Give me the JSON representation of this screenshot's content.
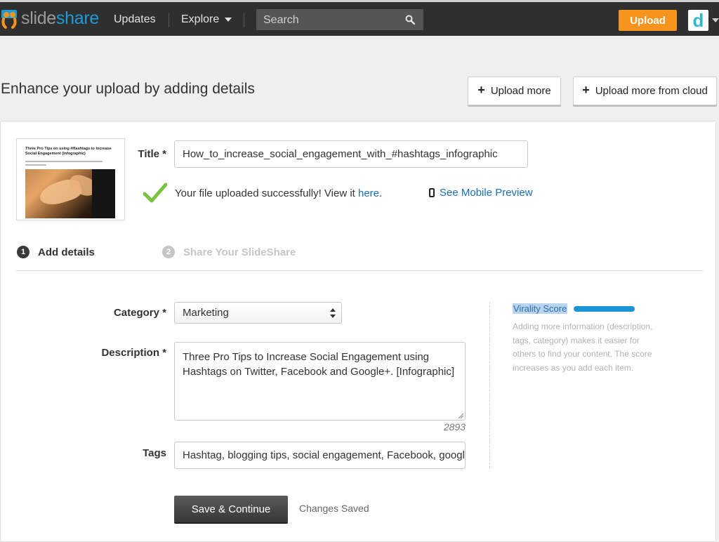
{
  "header": {
    "logo_part1": "slide",
    "logo_part2": "share",
    "nav": [
      "Updates",
      "Explore"
    ],
    "search_placeholder": "Search",
    "upload_label": "Upload",
    "avatar_letter": "d",
    "colors": {
      "bar": "#2f2f2f",
      "upload": "#f7941d",
      "brand_blue": "#1c9bd8"
    }
  },
  "page": {
    "title": "Enhance your upload by adding details",
    "upload_more": "Upload more",
    "upload_more_cloud": "Upload more from cloud"
  },
  "upload": {
    "thumb_title": "Three Pro Tips on using #Hashtags to Increase Social Engagement (Infographic)",
    "title_label": "Title *",
    "title_value": "How_to_increase_social_engagement_with_#hashtags_infographic",
    "success_text": "Your file uploaded successfully! View it ",
    "success_link": "here",
    "success_end": ".",
    "mobile_preview": "See Mobile Preview"
  },
  "steps": [
    {
      "num": "1",
      "label": "Add details"
    },
    {
      "num": "2",
      "label": "Share Your SlideShare"
    }
  ],
  "form": {
    "category_label": "Category *",
    "category_value": "Marketing",
    "description_label": "Description *",
    "description_value": "Three Pro Tips to Increase Social Engagement using Hashtags on Twitter, Facebook and Google+. [Infographic]",
    "description_counter": "2893",
    "tags_label": "Tags",
    "tags_value": "Hashtag, blogging tips, social engagement, Facebook, google"
  },
  "virality": {
    "label": "Virality Score",
    "help": "Adding more information (description, tags, category) makes it easier for others to find your content. The score increases as you add each item."
  },
  "actions": {
    "save_label": "Save & Continue",
    "status": "Changes Saved"
  }
}
